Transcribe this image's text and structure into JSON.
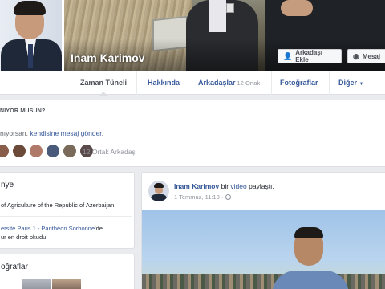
{
  "profile": {
    "name": "Inam Karimov",
    "buttons": {
      "add_friend": "Arkadaşı Ekle",
      "message": "Mesaj"
    }
  },
  "nav": {
    "timeline": "Zaman Tüneli",
    "about": "Hakkında",
    "friends": "Arkadaşlar",
    "friends_count": "12 Ortak",
    "photos": "Fotoğraflar",
    "more": "Diğer"
  },
  "know": {
    "title": "NIYOR MUSUN?",
    "line_prefix": "nıyorsan,",
    "line_link": "kendisine mesaj gönder",
    "line_suffix": ".",
    "mutual": "12 Ortak Arkadaş",
    "avatar_colors": [
      "#8a5c4a",
      "#6b4a3a",
      "#b07a6a",
      "#4a5a7a",
      "#7a6a5a",
      "#5a4a4a"
    ]
  },
  "intro": {
    "title": "nye",
    "line1": "of Agriculture of the Republic of Azerbaijan",
    "line2_link": "ersité Paris 1 - Panthéon Sorbonne",
    "line2_suffix": "'de",
    "line3": "ur en droit okudu"
  },
  "photos_card": {
    "title": "oğraflar"
  },
  "post": {
    "author": "Inam Karimov",
    "action_pre": "bir",
    "action_link": "video",
    "action_post": "paylaştı.",
    "time": "1 Temmuz, 11:18 ·",
    "privacy_icon": "globe-icon"
  },
  "colors": {
    "link": "#365899",
    "text": "#1d2129",
    "muted": "#90949c",
    "page_bg": "#e9ebee"
  }
}
